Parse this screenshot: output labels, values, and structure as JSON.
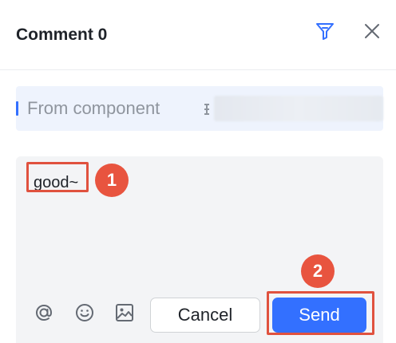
{
  "header": {
    "title": "Comment 0",
    "filter_icon": "filter-icon",
    "close_icon": "close-icon"
  },
  "source": {
    "label": "From component"
  },
  "composer": {
    "text": "good~",
    "tools": [
      "at-mention-icon",
      "emoji-icon",
      "image-icon"
    ],
    "cancel_label": "Cancel",
    "send_label": "Send"
  },
  "annotations": {
    "step1": "1",
    "step2": "2",
    "accent_color": "#e8543f"
  },
  "colors": {
    "primary": "#3370ff",
    "source_bg": "#eef3fd",
    "composer_bg": "#f3f4f6"
  }
}
